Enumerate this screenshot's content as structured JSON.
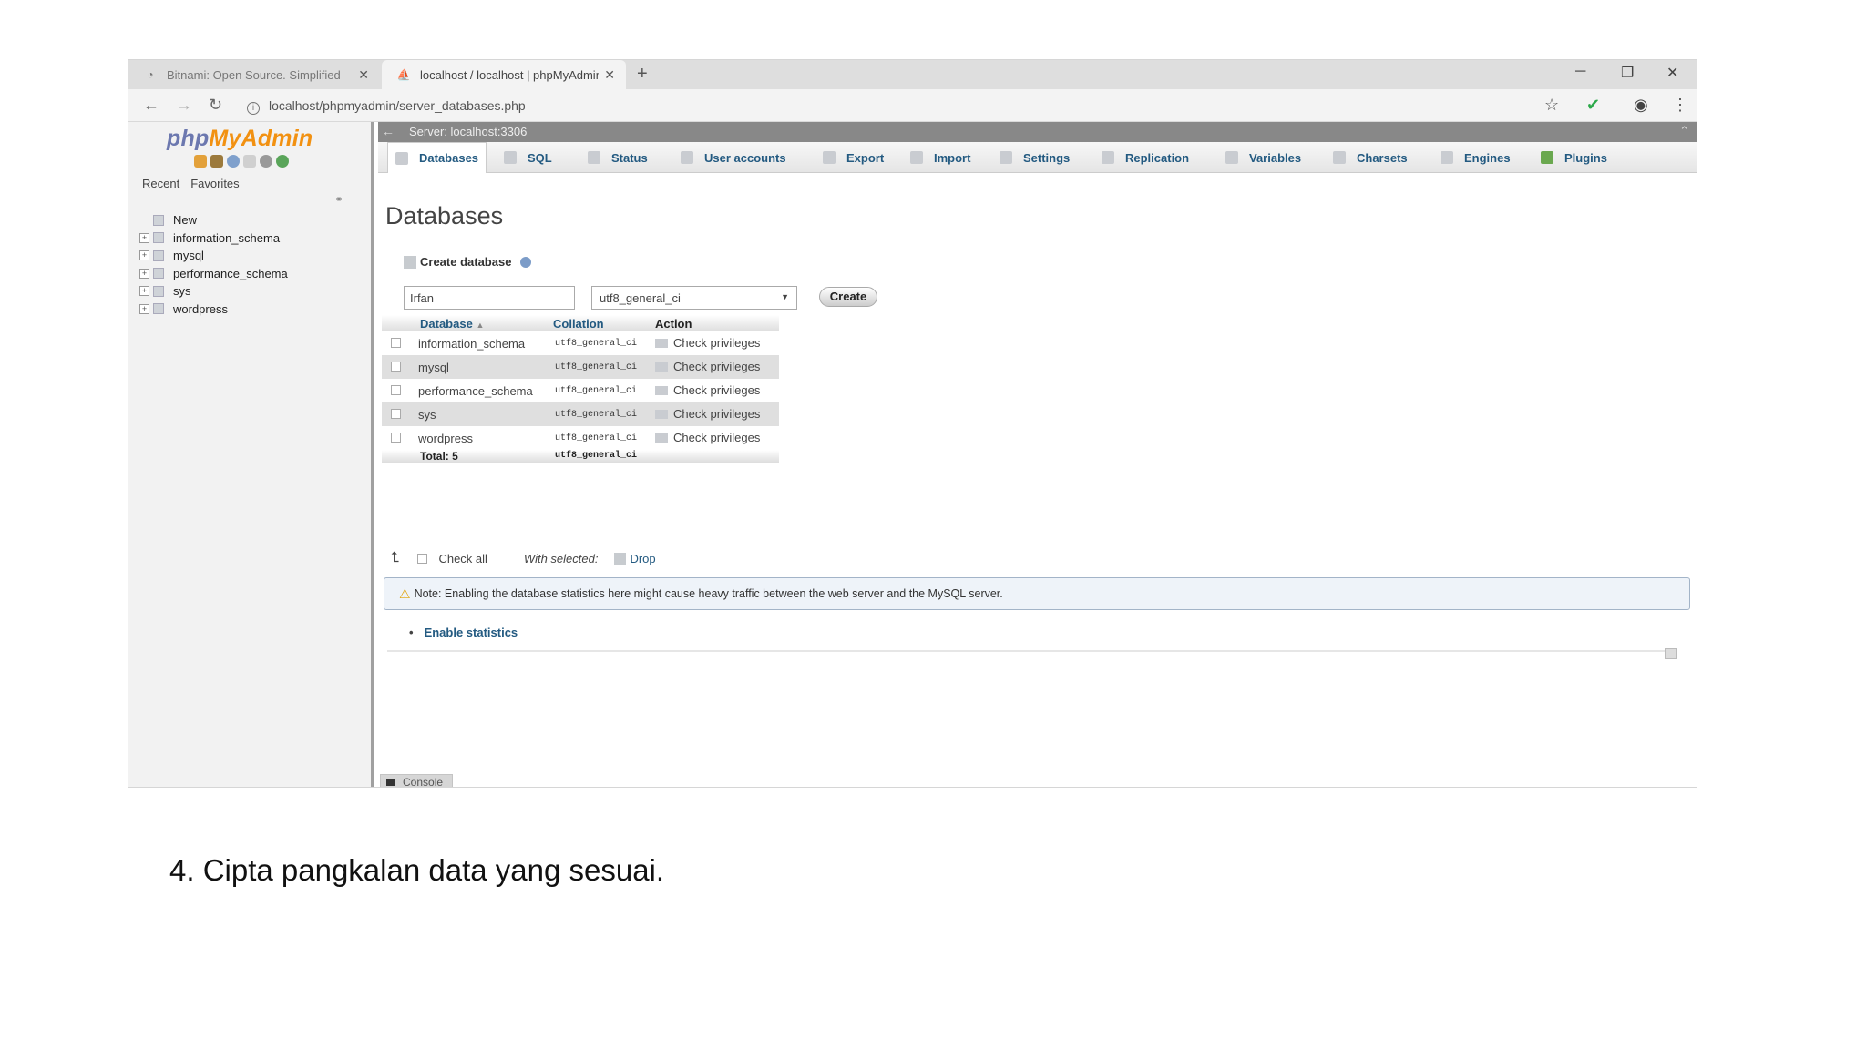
{
  "browser": {
    "tabs": [
      {
        "label": "Bitnami: Open Source. Simplified"
      },
      {
        "label": "localhost / localhost | phpMyAdmin"
      }
    ],
    "url": "localhost/phpmyadmin/server_databases.php"
  },
  "sidebar": {
    "logo": {
      "php": "php",
      "my": "My",
      "admin": "Admin"
    },
    "recent": "Recent",
    "favorites": "Favorites",
    "tree": [
      "New",
      "information_schema",
      "mysql",
      "performance_schema",
      "sys",
      "wordpress"
    ]
  },
  "server_label": "Server: localhost:3306",
  "menu": [
    "Databases",
    "SQL",
    "Status",
    "User accounts",
    "Export",
    "Import",
    "Settings",
    "Replication",
    "Variables",
    "Charsets",
    "Engines",
    "Plugins"
  ],
  "page_title": "Databases",
  "create": {
    "label": "Create database",
    "db_name_value": "Irfan",
    "collation": "utf8_general_ci",
    "button": "Create"
  },
  "table": {
    "headers": {
      "database": "Database",
      "collation": "Collation",
      "action": "Action"
    },
    "rows": [
      {
        "name": "information_schema",
        "collation": "utf8_general_ci",
        "action": "Check privileges"
      },
      {
        "name": "mysql",
        "collation": "utf8_general_ci",
        "action": "Check privileges"
      },
      {
        "name": "performance_schema",
        "collation": "utf8_general_ci",
        "action": "Check privileges"
      },
      {
        "name": "sys",
        "collation": "utf8_general_ci",
        "action": "Check privileges"
      },
      {
        "name": "wordpress",
        "collation": "utf8_general_ci",
        "action": "Check privileges"
      }
    ],
    "total_label": "Total: 5",
    "total_collation": "utf8_general_ci"
  },
  "with_selected": {
    "check_all": "Check all",
    "label": "With selected:",
    "drop": "Drop"
  },
  "notice": "Note: Enabling the database statistics here might cause heavy traffic between the web server and the MySQL server.",
  "enable_statistics": "Enable statistics",
  "console": "Console",
  "caption": "4. Cipta pangkalan data yang sesuai."
}
